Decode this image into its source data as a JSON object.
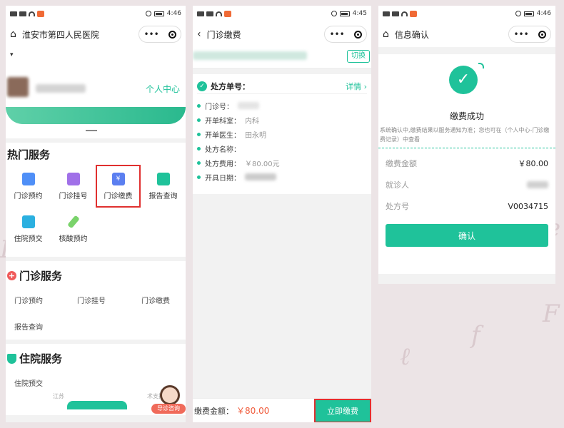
{
  "status": {
    "time1": "4:46",
    "time2": "4:45",
    "time3": "4:46"
  },
  "screen1": {
    "nav_title": "淮安市第四人民医院",
    "profile_link": "个人中心",
    "hot_title": "热门服务",
    "hot_items": [
      "门诊预约",
      "门诊挂号",
      "门诊缴费",
      "报告查询",
      "住院预交",
      "核酸预约"
    ],
    "outpatient_title": "门诊服务",
    "outpatient_items": [
      "门诊预约",
      "门诊挂号",
      "门诊缴费",
      "报告查询"
    ],
    "inpatient_title": "住院服务",
    "inpatient_items": [
      "住院预交"
    ],
    "footer_left": "江苏",
    "footer_right": "术支持",
    "consult_label": "导诊咨询"
  },
  "screen2": {
    "nav_title": "门诊缴费",
    "switch_label": "切换",
    "rx_label": "处方单号：",
    "detail_label": "详情 ›",
    "fields": [
      {
        "label": "门诊号：",
        "value": ""
      },
      {
        "label": "开单科室：",
        "value": "内科"
      },
      {
        "label": "开单医生：",
        "value": "田永明"
      },
      {
        "label": "处方名称：",
        "value": ""
      },
      {
        "label": "处方费用：",
        "value": "￥80.00元"
      },
      {
        "label": "开具日期：",
        "value": ""
      }
    ],
    "total_label": "缴费金额：",
    "total_value": "￥80.00",
    "pay_button": "立即缴费"
  },
  "screen3": {
    "nav_title": "信息确认",
    "success_title": "缴费成功",
    "notice": "系统确认中,缴费结果以服务通知为准；您也可在（个人中心-门诊缴费记录）中查看",
    "rows": [
      {
        "label": "缴费金额",
        "value": "￥80.00"
      },
      {
        "label": "就诊人",
        "value": ""
      },
      {
        "label": "处方号",
        "value": "V0034715"
      }
    ],
    "confirm_button": "确认"
  },
  "colors": {
    "accent": "#1fc29a",
    "highlight": "#e0302f",
    "price": "#f05a3a"
  }
}
